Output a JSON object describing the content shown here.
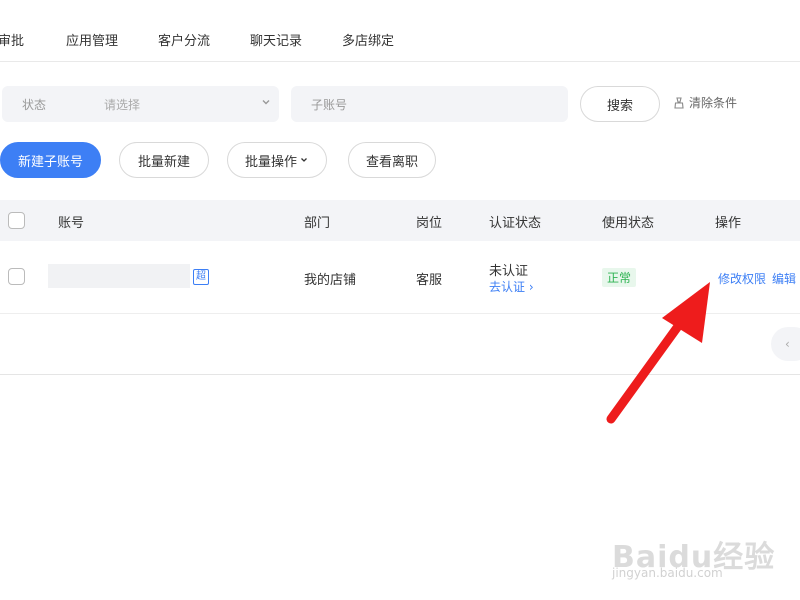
{
  "tabs": [
    "审批",
    "应用管理",
    "客户分流",
    "聊天记录",
    "多店绑定"
  ],
  "filters": {
    "status_label": "状态",
    "status_placeholder": "请选择",
    "sub_account_placeholder": "子账号"
  },
  "buttons": {
    "search": "搜索",
    "clear": "清除条件",
    "new_sub_account": "新建子账号",
    "batch_create": "批量新建",
    "batch_ops": "批量操作",
    "view_departed": "查看离职"
  },
  "table": {
    "headers": [
      "账号",
      "部门",
      "岗位",
      "认证状态",
      "使用状态",
      "操作"
    ],
    "rows": [
      {
        "account_tag": "超",
        "department": "我的店铺",
        "position": "客服",
        "auth_status": "未认证",
        "auth_link": "去认证",
        "use_status": "正常",
        "actions": [
          "修改权限",
          "编辑"
        ]
      }
    ]
  },
  "watermark": {
    "logo": "Baidu经验",
    "url": "jingyan.baidu.com"
  },
  "colors": {
    "primary": "#3d7ff5",
    "success": "#2eb352",
    "arrow": "#ee1c1c"
  }
}
